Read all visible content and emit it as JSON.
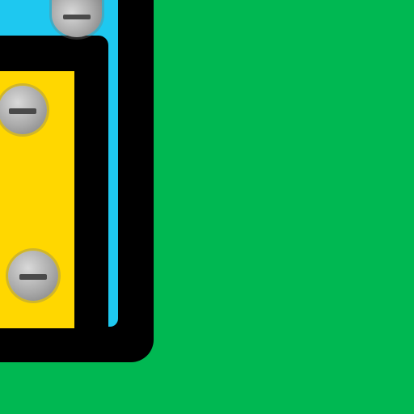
{
  "scene": {
    "background_color": "#00b852",
    "panel_color": "#1ec8f0",
    "tile_color": "#ffd700",
    "frame_color": "#000000"
  },
  "screws": [
    {
      "name": "screw-top-icon"
    },
    {
      "name": "screw-middle-icon"
    },
    {
      "name": "screw-bottom-icon"
    }
  ]
}
